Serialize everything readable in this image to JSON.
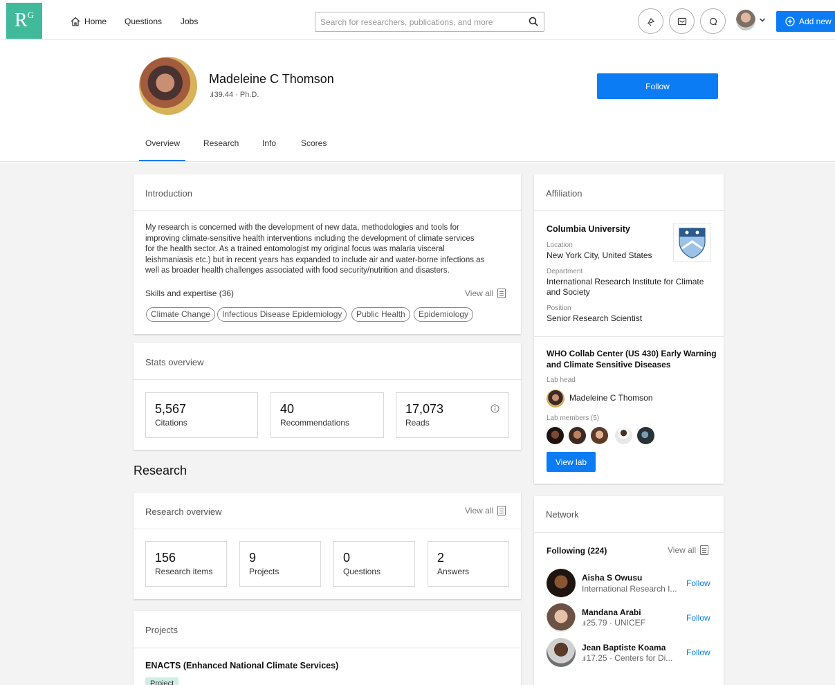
{
  "nav": {
    "logo_main": "R",
    "logo_sup": "G",
    "home": "Home",
    "questions": "Questions",
    "jobs": "Jobs",
    "search_placeholder": "Search for researchers, publications, and more",
    "add_new": "Add new"
  },
  "profile": {
    "name": "Madeleine C Thomson",
    "score_line": "39.44 · Ph.D.",
    "follow_label": "Follow"
  },
  "tabs": [
    "Overview",
    "Research",
    "Info",
    "Scores"
  ],
  "introduction": {
    "title": "Introduction",
    "lines": [
      "My research is concerned with the development of new data, methodologies and tools for",
      "improving climate-sensitive health interventions including the development of climate services",
      "for the health sector. As a trained entomologist my original focus was malaria visceral",
      "leishmaniasis etc.) but in recent years has expanded to include air and water-borne infections as",
      "well as broader health challenges associated with food security/nutrition and disasters."
    ],
    "skills_label": "Skills and expertise (36)",
    "view_all": "View all",
    "skills": [
      "Climate Change",
      "Infectious Disease Epidemiology",
      "Public Health",
      "Epidemiology"
    ]
  },
  "stats": {
    "title": "Stats overview",
    "items": [
      {
        "value": "5,567",
        "label": "Citations"
      },
      {
        "value": "40",
        "label": "Recommendations"
      },
      {
        "value": "17,073",
        "label": "Reads"
      }
    ]
  },
  "research": {
    "heading": "Research",
    "overview_title": "Research overview",
    "view_all": "View all",
    "items": [
      {
        "value": "156",
        "label": "Research items"
      },
      {
        "value": "9",
        "label": "Projects"
      },
      {
        "value": "0",
        "label": "Questions"
      },
      {
        "value": "2",
        "label": "Answers"
      }
    ]
  },
  "projects": {
    "title": "Projects",
    "first_project": "ENACTS (Enhanced National Climate Services)",
    "tag": "Project"
  },
  "affiliation": {
    "title": "Affiliation",
    "institution": "Columbia University",
    "location_label": "Location",
    "location": "New York City, United States",
    "department_label": "Department",
    "department_line1": "International Research Institute for Climate",
    "department_line2": "and Society",
    "position_label": "Position",
    "position": "Senior Research Scientist",
    "lab_line1": "WHO Collab Center (US 430) Early Warning",
    "lab_line2": "and Climate Sensitive Diseases",
    "lab_head_label": "Lab head",
    "lab_head": "Madeleine C Thomson",
    "lab_members_label": "Lab members (5)",
    "view_lab": "View lab"
  },
  "network": {
    "title": "Network",
    "following": "Following (224)",
    "view_all": "View all",
    "people": [
      {
        "name": "Aisha S Owusu",
        "sub": "International Research I...",
        "follow": "Follow"
      },
      {
        "name": "Mandana Arabi",
        "sub": "25.79 · UNICEF",
        "follow": "Follow"
      },
      {
        "name": "Jean Baptiste Koama",
        "sub": "17.25 · Centers for Di...",
        "follow": "Follow"
      }
    ]
  },
  "colors": {
    "accent": "#0c7cf4",
    "logo": "#40ba9b"
  }
}
